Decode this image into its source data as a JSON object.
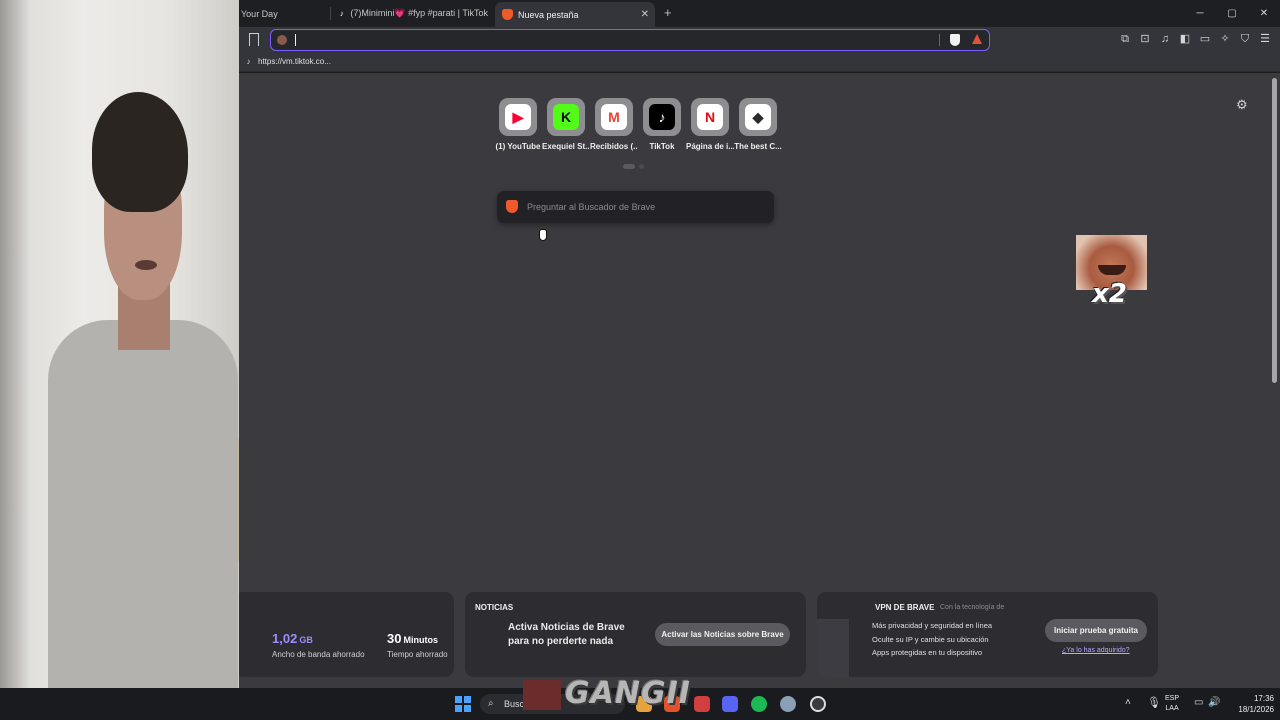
{
  "tabs": [
    {
      "label": "Your Day"
    },
    {
      "label": "(7)Minimini💗 #fyp #parati | TikTok"
    },
    {
      "label": "Nueva pestaña"
    }
  ],
  "window_controls": {
    "minimize": "─",
    "maximize": "▢",
    "close": "✕"
  },
  "new_tab_symbol": "+",
  "toolbar": {
    "url_value": "",
    "icons": [
      "extensions-icon",
      "screenshot-icon",
      "media-icon",
      "sidebar-icon",
      "wallet-icon",
      "leo-icon",
      "vpn-icon",
      "menu-icon"
    ]
  },
  "bookmarks": [
    {
      "label": "https://vm.tiktok.co..."
    }
  ],
  "top_sites": [
    {
      "label": "(1) YouTube",
      "glyph": "▶",
      "bg": "#ffffff",
      "fg": "#ff0033"
    },
    {
      "label": "Exequiel St...",
      "glyph": "K",
      "bg": "#53fc18",
      "fg": "#0b0b0b"
    },
    {
      "label": "Recibidos (...",
      "glyph": "M",
      "bg": "#ffffff",
      "fg": "#ea4335"
    },
    {
      "label": "TikTok",
      "glyph": "♪",
      "bg": "#000000",
      "fg": "#ffffff"
    },
    {
      "label": "Página de i...",
      "glyph": "N",
      "bg": "#ffffff",
      "fg": "#e50914"
    },
    {
      "label": "The best C...",
      "glyph": "◆",
      "bg": "#ffffff",
      "fg": "#2b2b2b"
    }
  ],
  "search": {
    "placeholder": "Preguntar al Buscador de Brave"
  },
  "meme": {
    "label": "x2"
  },
  "stats": [
    {
      "value": "1,02",
      "unit": "GB",
      "desc": "Ancho de banda ahorrado"
    },
    {
      "value": "30",
      "unit": "Minutos",
      "desc": "Tiempo ahorrado"
    }
  ],
  "news": {
    "title": "NOTICIAS",
    "body": "Activa Noticias de Brave para no perderte nada",
    "button": "Activar las Noticias sobre Brave"
  },
  "vpn": {
    "title": "VPN DE BRAVE",
    "subtitle": "Con la tecnología de",
    "bullets": [
      "Más privacidad y seguridad en línea",
      "Oculte su IP y cambie su ubicación",
      "Apps protegidas en tu dispositivo"
    ],
    "button": "Iniciar prueba gratuita",
    "link": "¿Ya lo has adquirido?"
  },
  "taskbar": {
    "search_text": "Buscar",
    "overlay_text": "GANGII",
    "lang_line1": "ESP",
    "lang_line2": "LAA",
    "time": "17:36",
    "date": "18/1/2026"
  }
}
